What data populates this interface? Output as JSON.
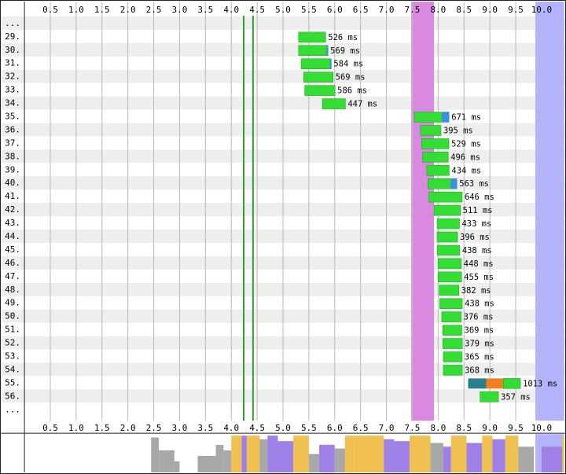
{
  "colors": {
    "row_alt": "#eeeeee",
    "grid": "#b8b8b8",
    "dom_interactive": "#2ea02e",
    "dom_content_loaded": "#2ea02e",
    "on_load": "#d98ae0",
    "fully_loaded": "#b3b3ff",
    "bar_download": "#33dd33",
    "bar_ttfb": "#3a8ee8",
    "bar_ssl": "#2a7f8f",
    "bar_connect": "#f08020",
    "cpu_layout": "#9f80e6",
    "cpu_script": "#f0c050",
    "cpu_other": "#a8a8a8"
  },
  "chart_data": {
    "type": "bar",
    "axis": {
      "min": 0,
      "max": 10.55,
      "unit": "s",
      "ticks": [
        "0.5",
        "1.0",
        "1.5",
        "2.0",
        "2.5",
        "3.0",
        "3.5",
        "4.0",
        "4.5",
        "5.0",
        "5.5",
        "6.0",
        "6.5",
        "7.0",
        "7.5",
        "8.0",
        "8.5",
        "9.0",
        "9.5",
        "10.0"
      ]
    },
    "rows_top_ellipsis": "...",
    "rows_bottom_ellipsis": "...",
    "markers": [
      {
        "name": "dom-interactive",
        "at": 4.24,
        "color_key": "dom_interactive"
      },
      {
        "name": "dom-content-loaded",
        "at": 4.42,
        "color_key": "dom_content_loaded"
      }
    ],
    "bands": [
      {
        "name": "on-load",
        "start": 7.48,
        "end": 7.92,
        "color_key": "on_load"
      },
      {
        "name": "fully-loaded",
        "start": 9.88,
        "end": 10.6,
        "color_key": "fully_loaded"
      }
    ],
    "requests": [
      {
        "label": "29.",
        "start": 5.3,
        "duration_ms": 526,
        "ttfb_ms": 0,
        "text": "526 ms"
      },
      {
        "label": "30.",
        "start": 5.3,
        "duration_ms": 569,
        "ttfb_ms": 30,
        "text": "569 ms"
      },
      {
        "label": "31.",
        "start": 5.35,
        "duration_ms": 584,
        "ttfb_ms": 30,
        "text": "584 ms"
      },
      {
        "label": "32.",
        "start": 5.4,
        "duration_ms": 569,
        "ttfb_ms": 0,
        "text": "569 ms"
      },
      {
        "label": "33.",
        "start": 5.42,
        "duration_ms": 586,
        "ttfb_ms": 0,
        "text": "586 ms"
      },
      {
        "label": "34.",
        "start": 5.76,
        "duration_ms": 447,
        "ttfb_ms": 0,
        "text": "447 ms"
      },
      {
        "label": "35.",
        "start": 7.54,
        "duration_ms": 671,
        "ttfb_ms": 140,
        "text": "671 ms"
      },
      {
        "label": "36.",
        "start": 7.66,
        "duration_ms": 395,
        "ttfb_ms": 0,
        "text": "395 ms"
      },
      {
        "label": "37.",
        "start": 7.68,
        "duration_ms": 529,
        "ttfb_ms": 0,
        "text": "529 ms"
      },
      {
        "label": "38.",
        "start": 7.7,
        "duration_ms": 496,
        "ttfb_ms": 0,
        "text": "496 ms"
      },
      {
        "label": "39.",
        "start": 7.78,
        "duration_ms": 434,
        "ttfb_ms": 0,
        "text": "434 ms"
      },
      {
        "label": "40.",
        "start": 7.8,
        "duration_ms": 563,
        "ttfb_ms": 120,
        "text": "563 ms"
      },
      {
        "label": "41.",
        "start": 7.82,
        "duration_ms": 646,
        "ttfb_ms": 0,
        "text": "646 ms"
      },
      {
        "label": "42.",
        "start": 7.92,
        "duration_ms": 511,
        "ttfb_ms": 0,
        "text": "511 ms"
      },
      {
        "label": "43.",
        "start": 7.98,
        "duration_ms": 433,
        "ttfb_ms": 0,
        "text": "433 ms"
      },
      {
        "label": "44.",
        "start": 7.98,
        "duration_ms": 396,
        "ttfb_ms": 0,
        "text": "396 ms"
      },
      {
        "label": "45.",
        "start": 7.98,
        "duration_ms": 438,
        "ttfb_ms": 0,
        "text": "438 ms"
      },
      {
        "label": "46.",
        "start": 8.0,
        "duration_ms": 448,
        "ttfb_ms": 0,
        "text": "448 ms"
      },
      {
        "label": "47.",
        "start": 8.0,
        "duration_ms": 455,
        "ttfb_ms": 0,
        "text": "455 ms"
      },
      {
        "label": "48.",
        "start": 8.02,
        "duration_ms": 382,
        "ttfb_ms": 0,
        "text": "382 ms"
      },
      {
        "label": "49.",
        "start": 8.03,
        "duration_ms": 438,
        "ttfb_ms": 0,
        "text": "438 ms"
      },
      {
        "label": "50.",
        "start": 8.07,
        "duration_ms": 376,
        "ttfb_ms": 0,
        "text": "376 ms"
      },
      {
        "label": "51.",
        "start": 8.09,
        "duration_ms": 369,
        "ttfb_ms": 0,
        "text": "369 ms"
      },
      {
        "label": "52.",
        "start": 8.09,
        "duration_ms": 379,
        "ttfb_ms": 0,
        "text": "379 ms"
      },
      {
        "label": "53.",
        "start": 8.1,
        "duration_ms": 365,
        "ttfb_ms": 0,
        "text": "365 ms"
      },
      {
        "label": "54.",
        "start": 8.1,
        "duration_ms": 368,
        "ttfb_ms": 0,
        "text": "368 ms"
      },
      {
        "label": "55.",
        "start": 8.58,
        "duration_ms": 1013,
        "ssl_ms": 350,
        "connect_ms": 330,
        "text": "1013 ms"
      },
      {
        "label": "56.",
        "start": 8.81,
        "duration_ms": 357,
        "ttfb_ms": 0,
        "text": "357 ms"
      }
    ],
    "cpu_activity": [
      {
        "start": 2.45,
        "end": 2.6,
        "level": 0.95,
        "kind": "other"
      },
      {
        "start": 2.6,
        "end": 2.9,
        "level": 0.6,
        "kind": "other"
      },
      {
        "start": 2.9,
        "end": 3.0,
        "level": 0.3,
        "kind": "other"
      },
      {
        "start": 3.35,
        "end": 3.7,
        "level": 0.45,
        "kind": "other"
      },
      {
        "start": 3.7,
        "end": 3.85,
        "level": 0.75,
        "kind": "other"
      },
      {
        "start": 3.85,
        "end": 4.0,
        "level": 0.6,
        "kind": "other"
      },
      {
        "start": 4.0,
        "end": 4.2,
        "level": 1.0,
        "kind": "script"
      },
      {
        "start": 4.2,
        "end": 4.3,
        "level": 1.0,
        "kind": "layout"
      },
      {
        "start": 4.3,
        "end": 4.55,
        "level": 1.0,
        "kind": "script"
      },
      {
        "start": 4.55,
        "end": 4.7,
        "level": 0.9,
        "kind": "other"
      },
      {
        "start": 4.7,
        "end": 4.9,
        "level": 1.0,
        "kind": "layout"
      },
      {
        "start": 4.9,
        "end": 5.2,
        "level": 0.85,
        "kind": "layout"
      },
      {
        "start": 5.2,
        "end": 5.5,
        "level": 1.0,
        "kind": "script"
      },
      {
        "start": 5.5,
        "end": 5.7,
        "level": 0.5,
        "kind": "other"
      },
      {
        "start": 5.7,
        "end": 6.0,
        "level": 0.75,
        "kind": "layout"
      },
      {
        "start": 6.0,
        "end": 6.2,
        "level": 0.65,
        "kind": "other"
      },
      {
        "start": 6.2,
        "end": 6.45,
        "level": 1.0,
        "kind": "script"
      },
      {
        "start": 6.45,
        "end": 6.95,
        "level": 1.0,
        "kind": "script"
      },
      {
        "start": 6.95,
        "end": 7.15,
        "level": 0.9,
        "kind": "layout"
      },
      {
        "start": 7.15,
        "end": 7.45,
        "level": 0.85,
        "kind": "layout"
      },
      {
        "start": 7.45,
        "end": 7.85,
        "level": 1.0,
        "kind": "script"
      },
      {
        "start": 7.85,
        "end": 8.1,
        "level": 0.8,
        "kind": "other"
      },
      {
        "start": 8.1,
        "end": 8.25,
        "level": 0.7,
        "kind": "layout"
      },
      {
        "start": 8.25,
        "end": 8.55,
        "level": 1.0,
        "kind": "script"
      },
      {
        "start": 8.55,
        "end": 8.85,
        "level": 0.8,
        "kind": "layout"
      },
      {
        "start": 8.85,
        "end": 9.05,
        "level": 1.0,
        "kind": "script"
      },
      {
        "start": 9.05,
        "end": 9.3,
        "level": 0.9,
        "kind": "layout"
      },
      {
        "start": 9.3,
        "end": 9.55,
        "level": 1.0,
        "kind": "script"
      },
      {
        "start": 9.55,
        "end": 9.85,
        "level": 0.7,
        "kind": "other"
      },
      {
        "start": 10.0,
        "end": 10.4,
        "level": 0.7,
        "kind": "layout"
      },
      {
        "start": 10.4,
        "end": 10.55,
        "level": 1.0,
        "kind": "script"
      }
    ]
  }
}
